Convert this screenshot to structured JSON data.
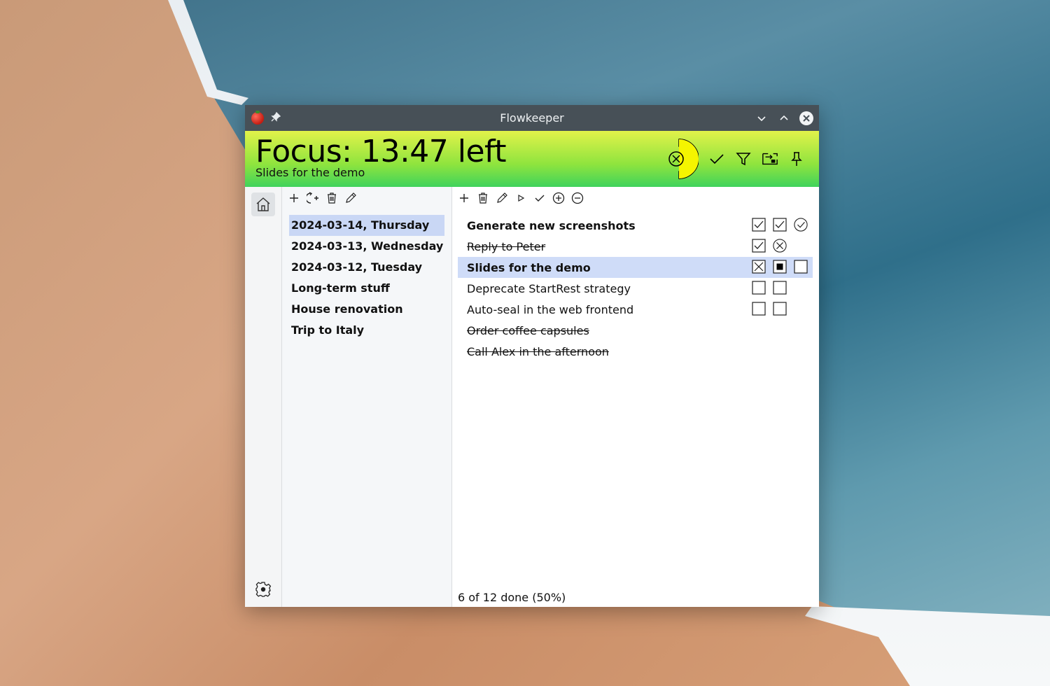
{
  "window": {
    "title": "Flowkeeper",
    "icons": [
      "tomato-icon",
      "pin-icon",
      "minimize-icon",
      "maximize-icon",
      "close-icon"
    ]
  },
  "focus": {
    "title": "Focus: 13:47 left",
    "subtitle": "Slides for the demo",
    "tools": [
      "void-pomodoro-icon",
      "complete-icon",
      "filter-icon",
      "move-icon",
      "pin-icon"
    ],
    "colors": {
      "top": "#e2f24a",
      "bottom": "#3fd35c",
      "timer": "#f5f500"
    }
  },
  "backlogs": {
    "toolbar": [
      "add-icon",
      "add-from-incomplete-icon",
      "delete-icon",
      "edit-icon"
    ],
    "items": [
      {
        "label": "2024-03-14, Thursday",
        "selected": true
      },
      {
        "label": "2024-03-13, Wednesday",
        "selected": false
      },
      {
        "label": "2024-03-12, Tuesday",
        "selected": false
      },
      {
        "label": "Long-term stuff",
        "selected": false
      },
      {
        "label": "House renovation",
        "selected": false
      },
      {
        "label": "Trip to Italy",
        "selected": false
      }
    ]
  },
  "workitems": {
    "toolbar": [
      "add-icon",
      "delete-icon",
      "edit-icon",
      "start-icon",
      "complete-icon",
      "add-pomodoro-icon",
      "remove-pomodoro-icon"
    ],
    "items": [
      {
        "label": "Generate new screenshots",
        "style": "bold",
        "pomodoros": [
          "checked",
          "checked",
          "circle-check"
        ]
      },
      {
        "label": "Reply to Peter",
        "style": "strike",
        "pomodoros": [
          "checked",
          "circle-x"
        ]
      },
      {
        "label": "Slides for the demo",
        "style": "bold",
        "selected": true,
        "pomodoros": [
          "crossed",
          "running",
          "empty"
        ]
      },
      {
        "label": "Deprecate StartRest strategy",
        "style": "normal",
        "pomodoros": [
          "empty",
          "empty"
        ]
      },
      {
        "label": "Auto-seal in the web frontend",
        "style": "normal",
        "pomodoros": [
          "empty",
          "empty"
        ]
      },
      {
        "label": "Order coffee capsules",
        "style": "strike",
        "pomodoros": []
      },
      {
        "label": "Call Alex in the afternoon",
        "style": "strike",
        "pomodoros": []
      }
    ],
    "status": "6 of 12 done (50%)"
  },
  "rail": {
    "icons": [
      "home-icon",
      "settings-icon"
    ]
  }
}
